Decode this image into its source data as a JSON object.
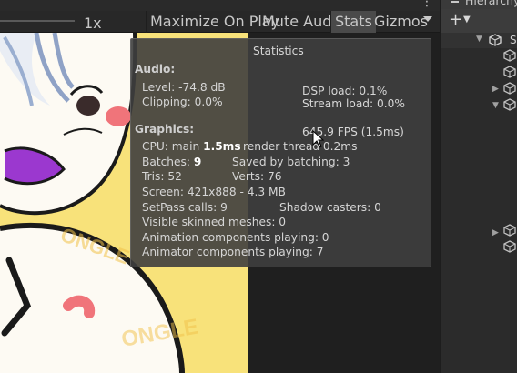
{
  "game_toolbar": {
    "scale_label": "1x",
    "buttons": {
      "maximize": "Maximize On Play",
      "mute": "Mute Audio",
      "stats": "Stats",
      "gizmos": "Gizmos"
    }
  },
  "statistics": {
    "title": "Statistics",
    "audio": {
      "heading": "Audio:",
      "level": "Level: -74.8 dB",
      "clipping": "Clipping: 0.0%",
      "dsp_load": "DSP load: 0.1%",
      "stream_load": "Stream load: 0.0%"
    },
    "graphics": {
      "heading": "Graphics:",
      "fps": "645.9 FPS (1.5ms)",
      "cpu_prefix": "CPU: main ",
      "cpu_main": "1.5ms",
      "render_thread": "render thread 0.2ms",
      "batches_prefix": "Batches: ",
      "batches": "9",
      "saved_by_batching": "Saved by batching: 3",
      "tris": "Tris: 52",
      "verts": "Verts: 76",
      "screen": "Screen: 421x888 - 4.3 MB",
      "setpass": "SetPass calls: 9",
      "shadow_casters": "Shadow casters: 0",
      "skinned_meshes": "Visible skinned meshes: 0",
      "animation_components": "Animation components playing: 0",
      "animator_components": "Animator components playing: 7"
    }
  },
  "hierarchy": {
    "tab_label": "Hierarchy",
    "add_label": "+",
    "scene_label": "Sa"
  },
  "colors": {
    "accent_active": "#4a4a4a",
    "panel_bg": "#282828",
    "canvas_yellow": "#f8e27a",
    "blush": "#f0747a",
    "purple": "#9b38cf"
  },
  "icons": {
    "add": "plus-icon",
    "dropdown": "dropdown-arrow-icon",
    "scene": "unity-scene-icon",
    "gameobject": "cube-icon",
    "expand": "triangle-right-icon",
    "kebab": "kebab-menu-icon",
    "cursor": "mouse-pointer-icon"
  }
}
